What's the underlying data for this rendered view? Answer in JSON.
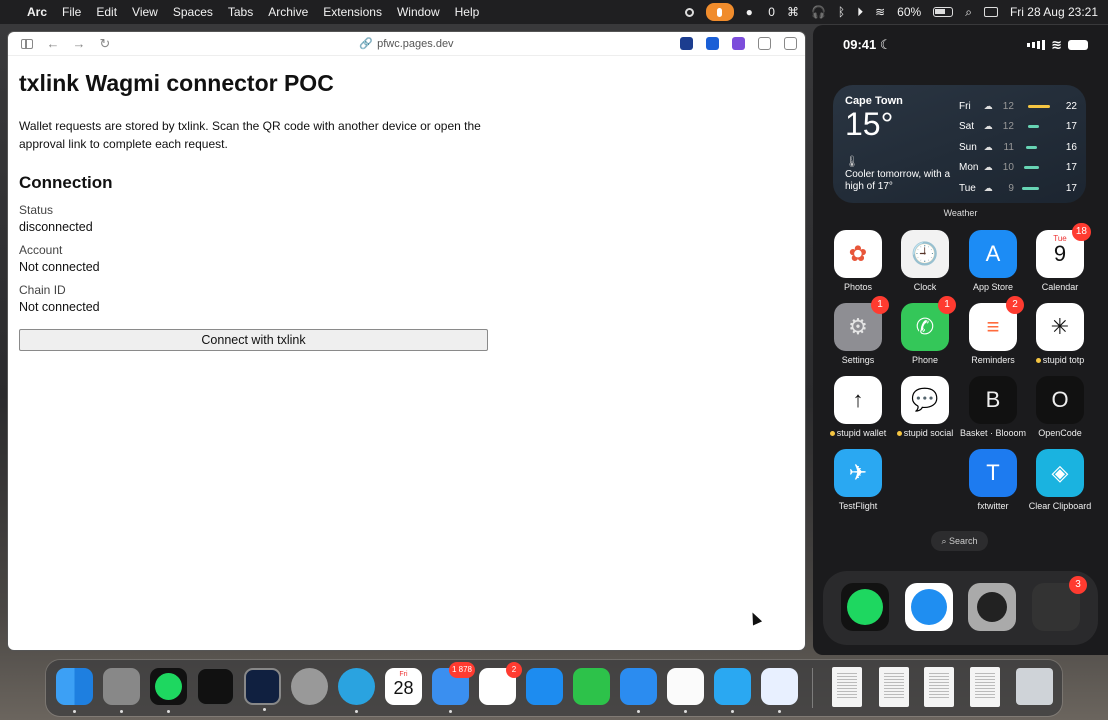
{
  "menubar": {
    "app": "Arc",
    "menus": [
      "File",
      "Edit",
      "View",
      "Spaces",
      "Tabs",
      "Archive",
      "Extensions",
      "Window",
      "Help"
    ],
    "count": "0",
    "battery": "60%",
    "datetime": "Fri 28 Aug  23:21"
  },
  "browser": {
    "url": "pfwc.pages.dev",
    "title": "txlink Wagmi connector POC",
    "intro": "Wallet requests are stored by txlink. Scan the QR code with another device or open the approval link to complete each request.",
    "section": "Connection",
    "fields": [
      {
        "label": "Status",
        "value": "disconnected"
      },
      {
        "label": "Account",
        "value": "Not connected"
      },
      {
        "label": "Chain ID",
        "value": "Not connected"
      }
    ],
    "button": "Connect with txlink"
  },
  "phone": {
    "time": "09:41",
    "weather": {
      "city": "Cape Town",
      "temp": "15°",
      "note": "Cooler tomorrow, with a high of 17°",
      "label": "Weather",
      "days": [
        {
          "day": "Fri",
          "lo": "12",
          "hi": "22"
        },
        {
          "day": "Sat",
          "lo": "12",
          "hi": "17"
        },
        {
          "day": "Sun",
          "lo": "11",
          "hi": "16"
        },
        {
          "day": "Mon",
          "lo": "10",
          "hi": "17"
        },
        {
          "day": "Tue",
          "lo": "9",
          "hi": "17"
        }
      ]
    },
    "apps": [
      {
        "name": "Photos",
        "glyph": "✿",
        "badge": "",
        "bg": "#ffffff",
        "fg": "#e8563a"
      },
      {
        "name": "Clock",
        "glyph": "🕘",
        "badge": "",
        "bg": "#f2f2f2",
        "fg": "#111111"
      },
      {
        "name": "App Store",
        "glyph": "A",
        "badge": "",
        "bg": "#1c8cf5",
        "fg": "#ffffff"
      },
      {
        "name": "Calendar",
        "glyph": "9",
        "badge": "18",
        "bg": "#ffffff",
        "fg": "#111111",
        "sub": "Tue"
      },
      {
        "name": "Settings",
        "glyph": "⚙",
        "badge": "1",
        "bg": "#8e8e93",
        "fg": "#e5e5e5"
      },
      {
        "name": "Phone",
        "glyph": "✆",
        "badge": "1",
        "bg": "#34c759",
        "fg": "#ffffff"
      },
      {
        "name": "Reminders",
        "glyph": "≡",
        "badge": "2",
        "bg": "#ffffff",
        "fg": "#ff6b3d"
      },
      {
        "name": "stupid totp",
        "glyph": "✳",
        "badge": "",
        "bg": "#ffffff",
        "fg": "#111111",
        "dot": true
      },
      {
        "name": "stupid wallet",
        "glyph": "↑",
        "badge": "",
        "bg": "#ffffff",
        "fg": "#111111",
        "dot": true
      },
      {
        "name": "stupid social",
        "glyph": "💬",
        "badge": "",
        "bg": "#ffffff",
        "fg": "#111111",
        "dot": true
      },
      {
        "name": "Basket · Blooom",
        "glyph": "B",
        "badge": "",
        "bg": "#111111",
        "fg": "#eeeeee"
      },
      {
        "name": "OpenCode",
        "glyph": "O",
        "badge": "",
        "bg": "#111111",
        "fg": "#eeeeee"
      },
      {
        "name": "TestFlight",
        "glyph": "✈",
        "badge": "",
        "bg": "#2aa8f2",
        "fg": "#ffffff"
      },
      {
        "name": "fxtwitter",
        "glyph": "T",
        "badge": "",
        "bg": "#1d7bf0",
        "fg": "#ffffff"
      },
      {
        "name": "Clear Clipboard",
        "glyph": "◈",
        "badge": "",
        "bg": "#1ab3e0",
        "fg": "#ffffff"
      }
    ],
    "search": "Search",
    "dock_badge": "3"
  },
  "dock": {
    "calendar_day": "Fri",
    "calendar_date": "28",
    "mail_badge": "1 878",
    "reminders_badge": "2"
  },
  "colors": {
    "accent_orange": "#f08c2c",
    "badge_red": "#ff3b30"
  }
}
